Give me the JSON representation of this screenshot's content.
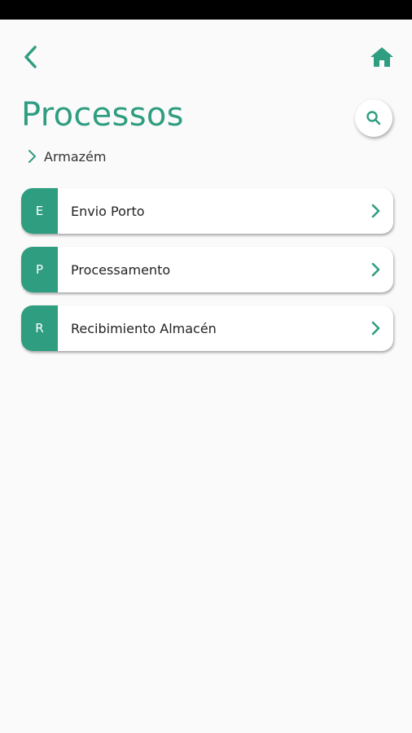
{
  "header": {
    "back_icon": "chevron-left-icon",
    "home_icon": "home-icon"
  },
  "page": {
    "title": "Processos",
    "search_icon": "search-icon"
  },
  "breadcrumb": {
    "icon": "chevron-right-icon",
    "label": "Armazém"
  },
  "processes": [
    {
      "badge": "E",
      "label": "Envio Porto"
    },
    {
      "badge": "P",
      "label": "Processamento"
    },
    {
      "badge": "R",
      "label": "Recibimiento Almacén"
    }
  ],
  "colors": {
    "accent": "#2f9d80",
    "background": "#fafafa",
    "status_bar": "#000000"
  }
}
